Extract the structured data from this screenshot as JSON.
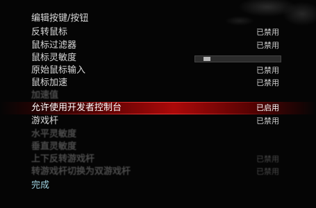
{
  "menu": {
    "items": [
      {
        "label": "编辑按键/按钮",
        "value": ""
      },
      {
        "label": "反转鼠标",
        "value": "已禁用"
      },
      {
        "label": "鼠标过滤器",
        "value": "已禁用"
      },
      {
        "label": "鼠标灵敏度",
        "value": ""
      },
      {
        "label": "原始鼠标输入",
        "value": "已禁用"
      },
      {
        "label": "鼠标加速",
        "value": "已禁用"
      },
      {
        "label": "加速值",
        "value": ""
      },
      {
        "label": "允许使用开发者控制台",
        "value": "已启用"
      },
      {
        "label": "游戏杆",
        "value": "已禁用"
      },
      {
        "label": "水平灵敏度",
        "value": ""
      },
      {
        "label": "垂直灵敏度",
        "value": ""
      },
      {
        "label": "上下反转游戏杆",
        "value": "已禁用"
      },
      {
        "label": "转游戏杆切换为双游戏杆",
        "value": "已禁用"
      }
    ],
    "done_label": "完成"
  },
  "mouse_sensitivity": {
    "level": 0.1
  },
  "colors": {
    "highlight": "#c80a0a",
    "done_text": "#9fd2e0"
  }
}
